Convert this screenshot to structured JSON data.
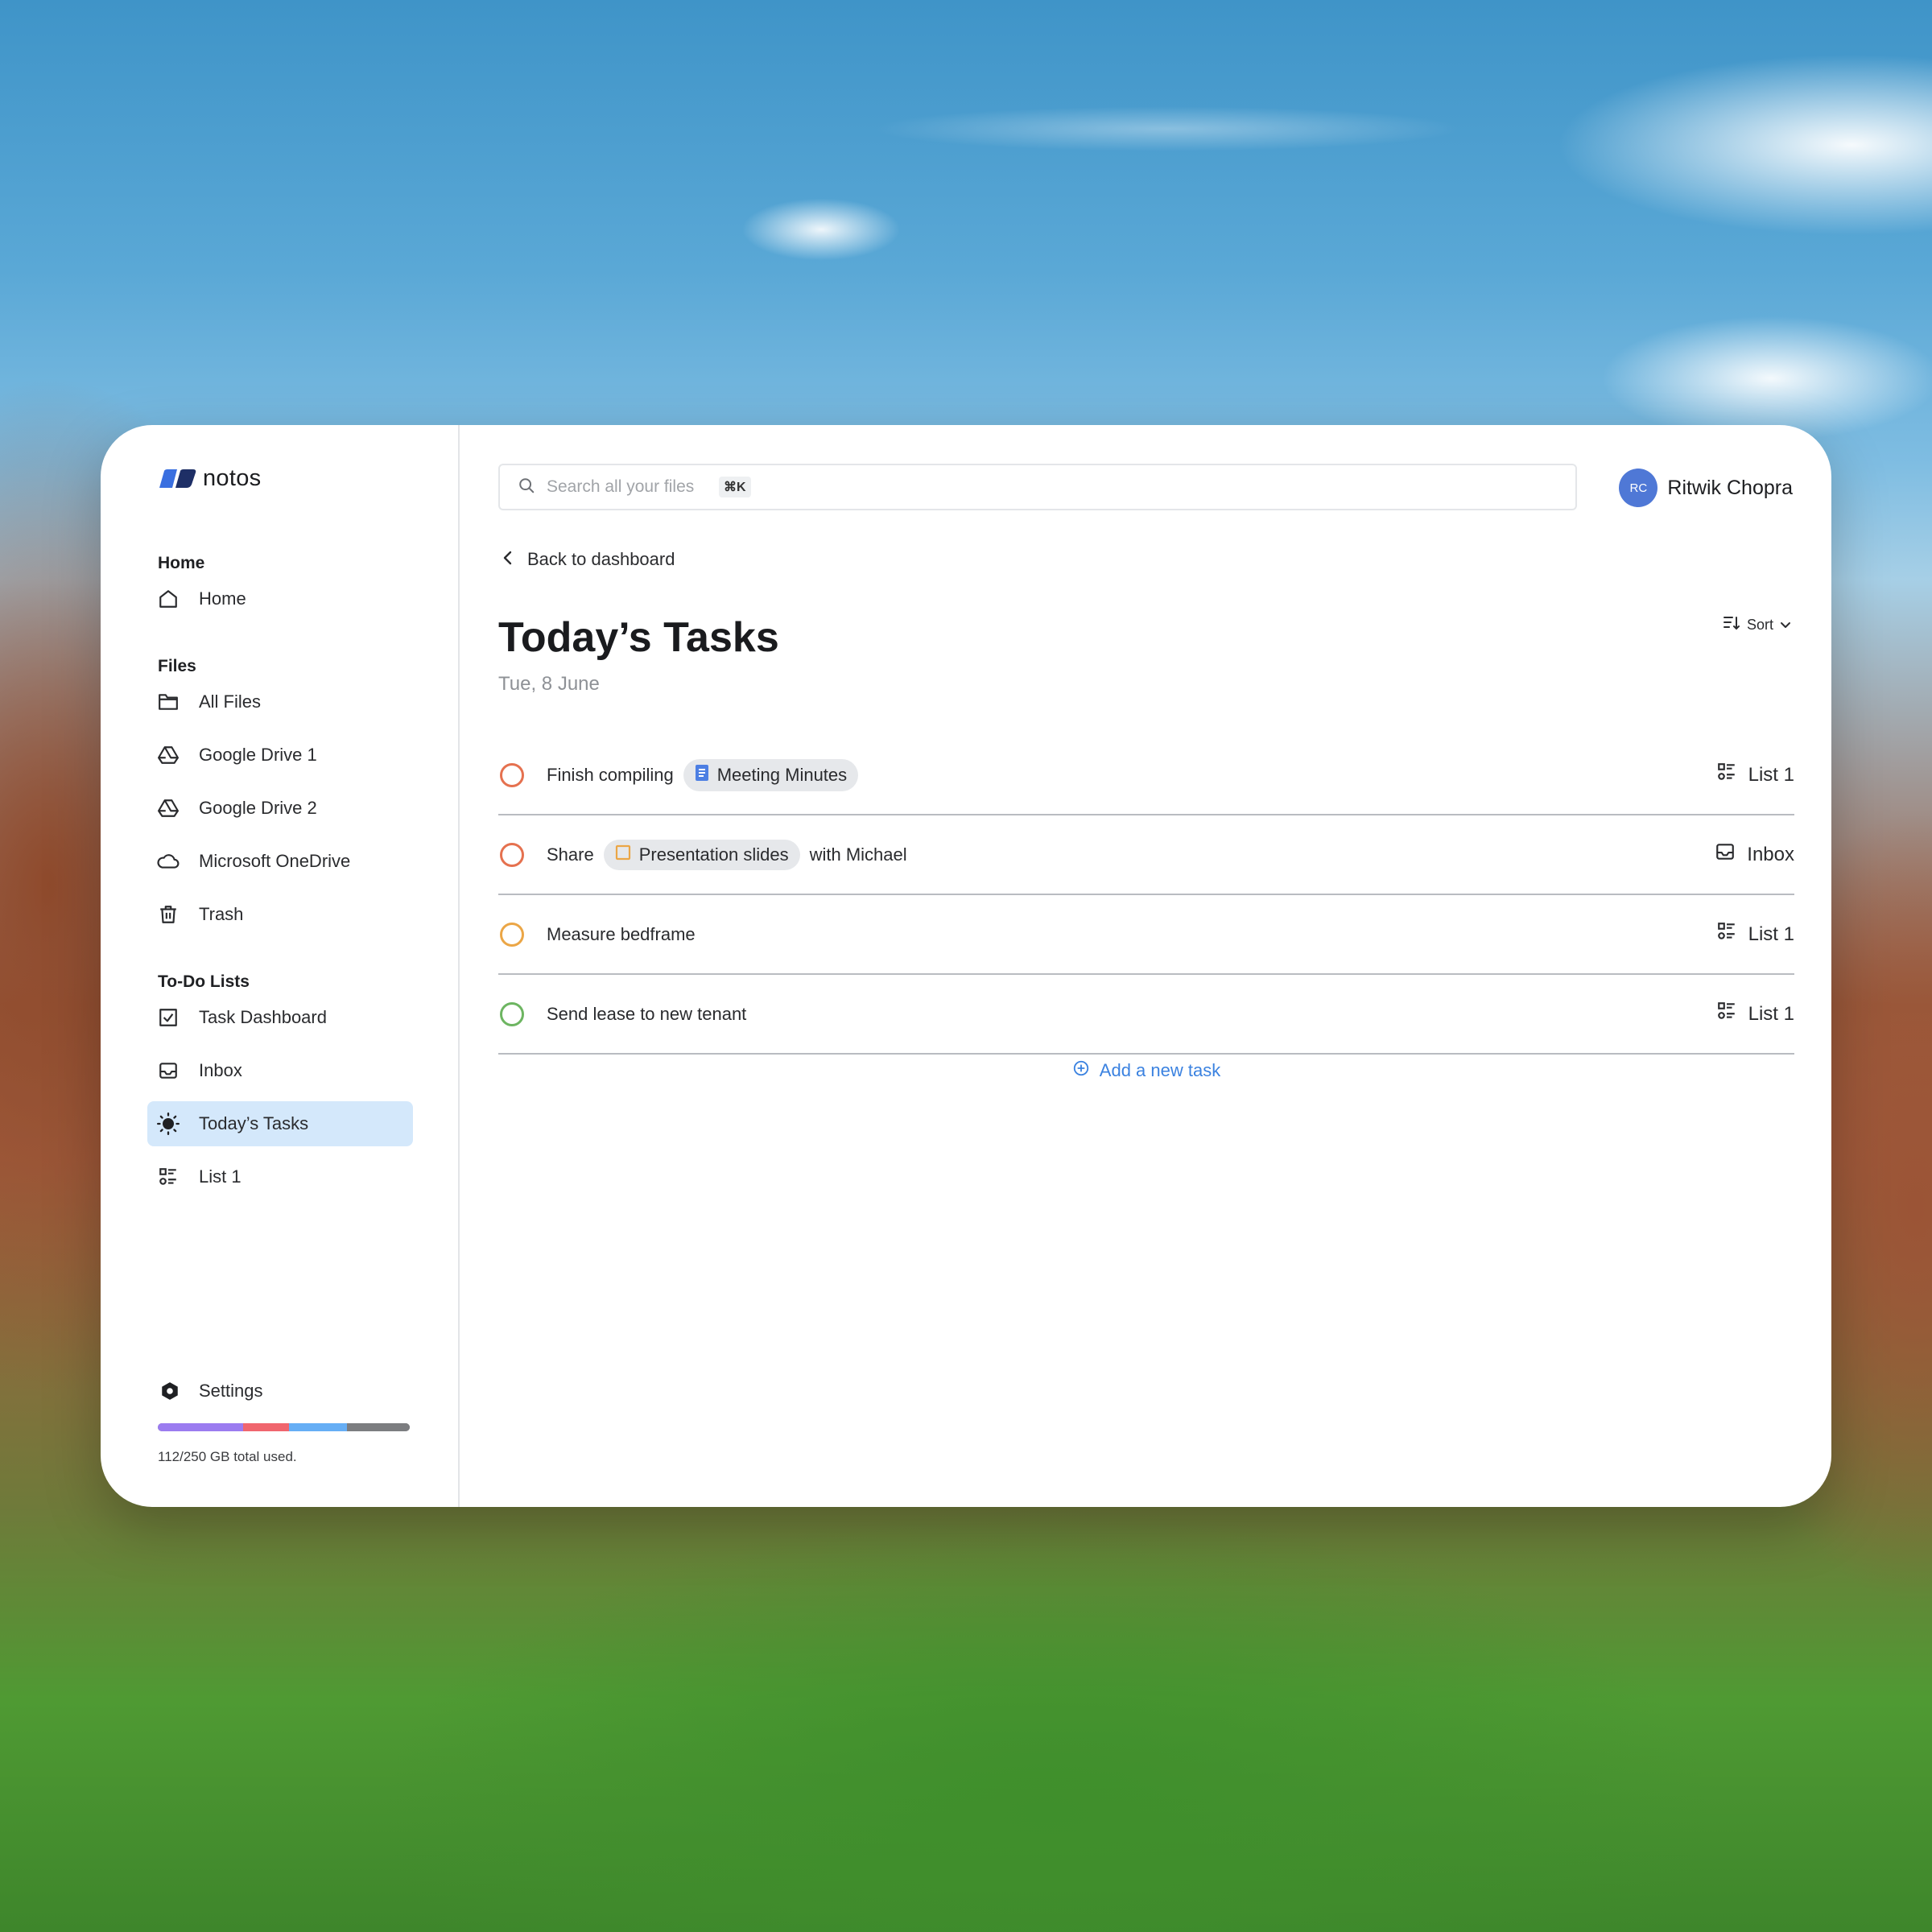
{
  "app": {
    "name": "notos"
  },
  "sidebar": {
    "sections": [
      {
        "heading": "Home",
        "items": [
          {
            "label": "Home",
            "icon": "home-icon"
          }
        ]
      },
      {
        "heading": "Files",
        "items": [
          {
            "label": "All Files",
            "icon": "folder-icon"
          },
          {
            "label": "Google Drive 1",
            "icon": "google-drive-icon"
          },
          {
            "label": "Google Drive 2",
            "icon": "google-drive-icon"
          },
          {
            "label": "Microsoft OneDrive",
            "icon": "cloud-icon"
          },
          {
            "label": "Trash",
            "icon": "trash-icon"
          }
        ]
      },
      {
        "heading": "To-Do Lists",
        "items": [
          {
            "label": "Task Dashboard",
            "icon": "checkbox-icon"
          },
          {
            "label": "Inbox",
            "icon": "inbox-icon"
          },
          {
            "label": "Today’s Tasks",
            "icon": "sun-icon",
            "active": true
          },
          {
            "label": "List 1",
            "icon": "list-icon"
          }
        ]
      }
    ],
    "settings_label": "Settings",
    "storage": {
      "text": "112/250 GB total used.",
      "used_fraction": 0.448,
      "segments": [
        {
          "color": "#9b7cf0",
          "fraction": 0.34
        },
        {
          "color": "#f0666e",
          "fraction": 0.18
        },
        {
          "color": "#66aef5",
          "fraction": 0.23
        },
        {
          "color": "#7c7d80",
          "fraction": 0.25
        }
      ]
    }
  },
  "header": {
    "search_placeholder": "Search all your files",
    "shortcut": "⌘K",
    "user": {
      "initials": "RC",
      "name": "Ritwik Chopra"
    }
  },
  "page": {
    "back_label": "Back to dashboard",
    "title": "Today’s Tasks",
    "date": "Tue, 8 June",
    "sort_label": "Sort",
    "add_task_label": "Add a new task"
  },
  "tasks": [
    {
      "before": "Finish compiling",
      "chip": "Meeting Minutes",
      "chip_icon": "doc-icon",
      "after": "",
      "list": "List 1",
      "list_icon": "list-icon",
      "circle_color": "#e5714f"
    },
    {
      "before": "Share",
      "chip": "Presentation slides",
      "chip_icon": "slides-icon",
      "after": "with Michael",
      "list": "Inbox",
      "list_icon": "inbox-icon",
      "circle_color": "#e5714f"
    },
    {
      "before": "Measure bedframe",
      "chip": "",
      "after": "",
      "list": "List 1",
      "list_icon": "list-icon",
      "circle_color": "#eba646"
    },
    {
      "before": "Send lease to new tenant",
      "chip": "",
      "after": "",
      "list": "List 1",
      "list_icon": "list-icon",
      "circle_color": "#6db561"
    }
  ],
  "colors": {
    "accent": "#3b82e0",
    "active_bg": "#d4e8fb"
  }
}
